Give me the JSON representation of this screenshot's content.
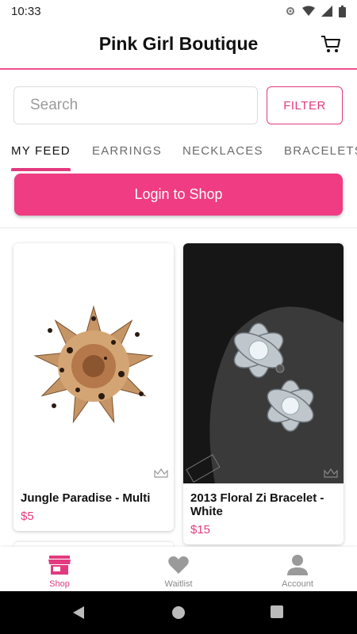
{
  "status": {
    "time": "10:33"
  },
  "app": {
    "title": "Pink Girl Boutique"
  },
  "search": {
    "placeholder": "Search",
    "filter_label": "FILTER"
  },
  "tabs": [
    {
      "label": "MY FEED",
      "active": true
    },
    {
      "label": "EARRINGS"
    },
    {
      "label": "NECKLACES"
    },
    {
      "label": "BRACELETS"
    }
  ],
  "login_label": "Login to Shop",
  "products": [
    {
      "name": "Jungle Paradise - Multi",
      "price": "$5"
    },
    {
      "name": "2013 Floral Zi Bracelet - White",
      "price": "$15"
    }
  ],
  "nav": [
    {
      "label": "Shop",
      "icon": "store-icon",
      "active": true
    },
    {
      "label": "Waitlist",
      "icon": "heart-icon"
    },
    {
      "label": "Account",
      "icon": "person-icon"
    }
  ],
  "colors": {
    "accent": "#e23a7f",
    "button": "#ef3c82"
  }
}
